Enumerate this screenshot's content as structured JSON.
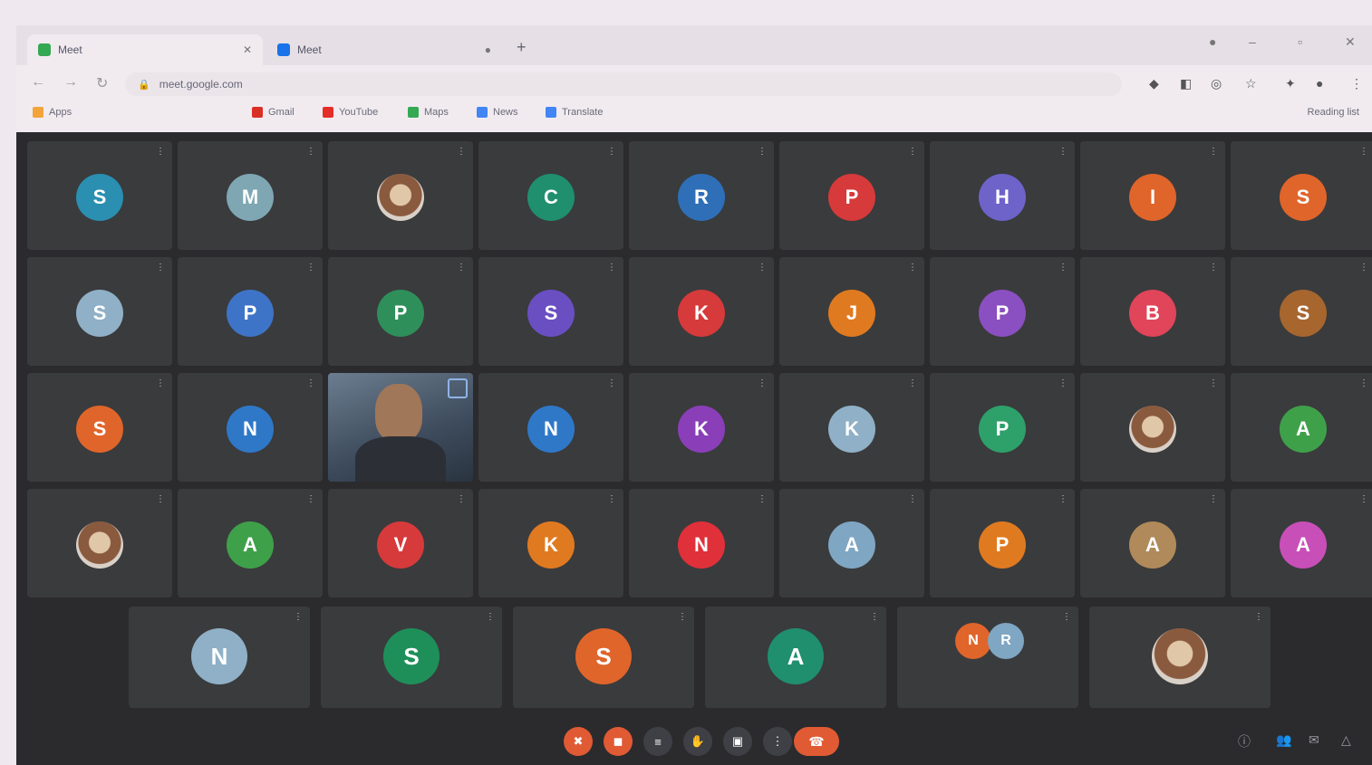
{
  "browser": {
    "tabs": [
      {
        "label": "Meet",
        "favicon_color": "#34a853"
      },
      {
        "label": "Meet",
        "favicon_color": "#1a73e8"
      }
    ],
    "url": "meet.google.com",
    "bookmarks": [
      "Apps",
      "Gmail",
      "YouTube",
      "Maps",
      "News",
      "Translate"
    ],
    "reading_list": "Reading list"
  },
  "participants": [
    {
      "initial": "S",
      "color": "#2a8fb0"
    },
    {
      "initial": "M",
      "color": "#7fa6b3"
    },
    {
      "initial": "",
      "color": "#c86a3a",
      "photo": true
    },
    {
      "initial": "C",
      "color": "#1f8f6e"
    },
    {
      "initial": "R",
      "color": "#2e6fb8"
    },
    {
      "initial": "P",
      "color": "#d63a3a"
    },
    {
      "initial": "H",
      "color": "#6d63c9"
    },
    {
      "initial": "I",
      "color": "#e0652a"
    },
    {
      "initial": "S",
      "color": "#e0652a"
    },
    {
      "initial": "S",
      "color": "#8fb0c6"
    },
    {
      "initial": "P",
      "color": "#3e74c8"
    },
    {
      "initial": "P",
      "color": "#2e8f5a"
    },
    {
      "initial": "S",
      "color": "#6a4fc2"
    },
    {
      "initial": "K",
      "color": "#d63a3a"
    },
    {
      "initial": "J",
      "color": "#e07a20"
    },
    {
      "initial": "P",
      "color": "#8a4fc0"
    },
    {
      "initial": "B",
      "color": "#e0455a"
    },
    {
      "initial": "S",
      "color": "#a7662e"
    },
    {
      "initial": "S",
      "color": "#e0652a"
    },
    {
      "initial": "N",
      "color": "#2f78c8"
    },
    {
      "initial": "",
      "color": "#000000",
      "video": true
    },
    {
      "initial": "N",
      "color": "#2f78c8"
    },
    {
      "initial": "K",
      "color": "#8a3fb8"
    },
    {
      "initial": "K",
      "color": "#8fb0c6"
    },
    {
      "initial": "P",
      "color": "#2ea06a"
    },
    {
      "initial": "",
      "color": "#888",
      "photo": true
    },
    {
      "initial": "A",
      "color": "#3fa04a"
    },
    {
      "initial": "",
      "color": "#c89a5a",
      "photo": true
    },
    {
      "initial": "A",
      "color": "#3fa04a"
    },
    {
      "initial": "V",
      "color": "#d63a3a"
    },
    {
      "initial": "K",
      "color": "#e07a20"
    },
    {
      "initial": "N",
      "color": "#e0303a"
    },
    {
      "initial": "A",
      "color": "#7fa6c3"
    },
    {
      "initial": "P",
      "color": "#e07a20"
    },
    {
      "initial": "A",
      "color": "#b08a5a"
    },
    {
      "initial": "A",
      "color": "#c84fb8"
    }
  ],
  "last_row": [
    {
      "initial": "N",
      "color": "#8fb0c6"
    },
    {
      "initial": "S",
      "color": "#1f8f5a"
    },
    {
      "initial": "S",
      "color": "#e0652a"
    },
    {
      "initial": "A",
      "color": "#1f8f6e"
    },
    {
      "initial": "N",
      "color": "#e0652a",
      "pair": true,
      "initial2": "R",
      "color2": "#7fa6c3"
    },
    {
      "initial": "",
      "color": "#ddd",
      "photo": true
    }
  ],
  "controls": {
    "buttons": [
      {
        "name": "mic-button",
        "color": "#e05a34",
        "icon": "✖"
      },
      {
        "name": "camera-button",
        "color": "#e05a34",
        "icon": "◼"
      },
      {
        "name": "captions-button",
        "color": "#3f4045",
        "icon": "≡"
      },
      {
        "name": "raise-hand-button",
        "color": "#3f4045",
        "icon": "✋"
      },
      {
        "name": "present-button",
        "color": "#3f4045",
        "icon": "▣"
      },
      {
        "name": "more-options-button",
        "color": "#3f4045",
        "icon": "⋮"
      }
    ],
    "end_call_icon": "☎"
  }
}
